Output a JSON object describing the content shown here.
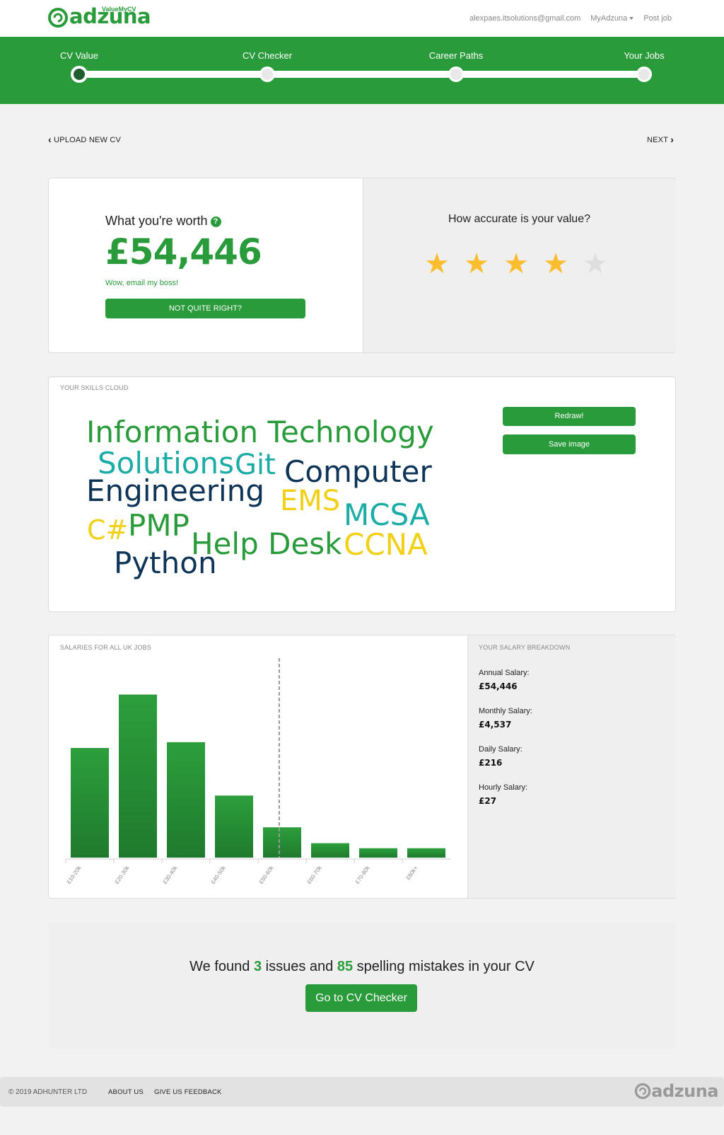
{
  "header": {
    "brand": "adzuna",
    "brand_tag": "ValueMyCV",
    "email": "alexpaes.itsolutions@gmail.com",
    "myadzuna": "MyAdzuna",
    "post_job": "Post job"
  },
  "steps": [
    {
      "label": "CV Value",
      "active": true
    },
    {
      "label": "CV Checker",
      "active": false
    },
    {
      "label": "Career Paths",
      "active": false
    },
    {
      "label": "Your Jobs",
      "active": false
    }
  ],
  "nav": {
    "back": "UPLOAD NEW CV",
    "next": "NEXT"
  },
  "worth": {
    "title": "What you're worth",
    "value": "£54,446",
    "subtitle": "Wow, email my boss!",
    "button": "NOT QUITE RIGHT?"
  },
  "accuracy": {
    "title": "How accurate is your value?",
    "rating": 4,
    "max": 5
  },
  "skills": {
    "label": "YOUR SKILLS CLOUD",
    "redraw": "Redraw!",
    "save": "Save image",
    "words": [
      "Information Technology",
      "Solutions",
      "Git",
      "Computer",
      "Engineering",
      "EMS",
      "MCSA",
      "C#",
      "PMP",
      "Help Desk",
      "CCNA",
      "Python"
    ]
  },
  "salaries": {
    "label": "SALARIES FOR ALL UK JOBS"
  },
  "chart_data": {
    "type": "bar",
    "categories": [
      "£10-20k",
      "£20-30k",
      "£30-40k",
      "£40-50k",
      "£50-60k",
      "£60-70k",
      "£70-80k",
      "£80k+"
    ],
    "values": [
      152,
      226,
      160,
      86,
      42,
      20,
      13,
      13
    ],
    "marker": {
      "category": "£50-60k",
      "position": 0.44,
      "style": "dashed"
    },
    "ylim": [
      0,
      255
    ],
    "color": "#2a9b3a",
    "title": "",
    "xlabel": "",
    "ylabel": ""
  },
  "breakdown": {
    "label": "YOUR SALARY BREAKDOWN",
    "annual_label": "Annual Salary:",
    "annual": "£54,446",
    "monthly_label": "Monthly Salary:",
    "monthly": "£4,537",
    "daily_label": "Daily Salary:",
    "daily": "£216",
    "hourly_label": "Hourly Salary:",
    "hourly": "£27"
  },
  "checker": {
    "pre": "We found",
    "issues": "3",
    "mid": "issues and",
    "mistakes": "85",
    "post": "spelling mistakes in your CV",
    "button": "Go to CV Checker"
  },
  "footer": {
    "copyright": "© 2019 ADHUNTER LTD",
    "about": "ABOUT US",
    "feedback": "GIVE US FEEDBACK",
    "brand": "adzuna"
  },
  "colors": {
    "brand": "#2a9b3a",
    "navy": "#0e3558",
    "teal": "#1aaca5",
    "yellow": "#f2d015",
    "star": "#f9bd2d"
  }
}
